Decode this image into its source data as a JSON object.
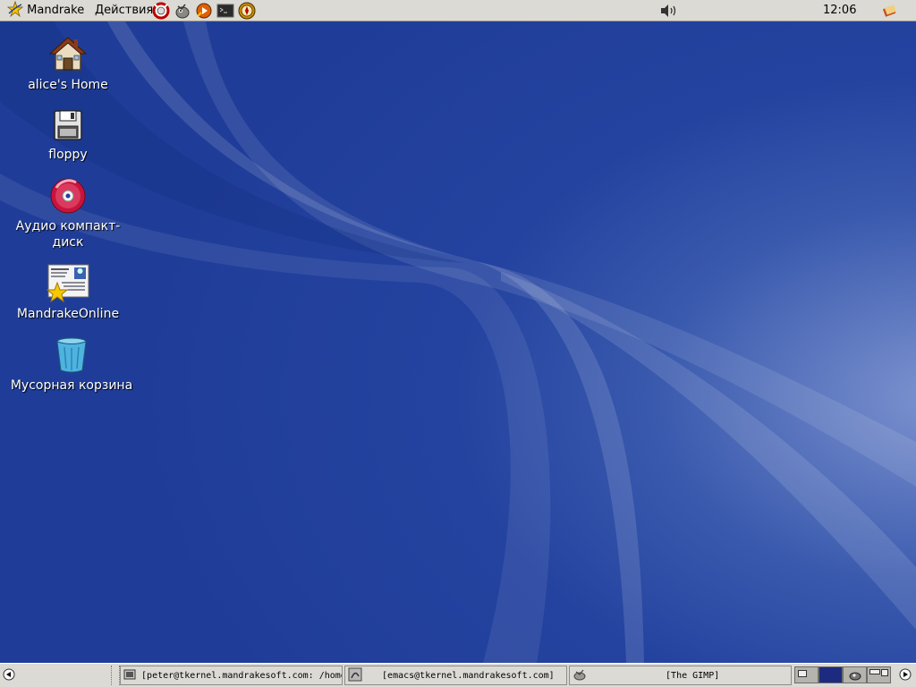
{
  "top_panel": {
    "menu_main": "Mandrake",
    "menu_actions": "Действия",
    "launchers": [
      "lifebuoy-icon",
      "gimp-icon",
      "media-player-icon",
      "terminal-icon",
      "browser-icon"
    ],
    "volume_icon": "speaker-icon",
    "clock": "12:06",
    "notification_icon": "notes-icon"
  },
  "desktop": {
    "icons": [
      {
        "label": "alice's Home",
        "icon": "home-icon"
      },
      {
        "label": "floppy",
        "icon": "floppy-icon"
      },
      {
        "label": "Аудио компакт-диск",
        "icon": "cd-icon"
      },
      {
        "label": "MandrakeOnline",
        "icon": "mandrakeonline-icon"
      },
      {
        "label": "Мусорная корзина",
        "icon": "trash-icon"
      }
    ]
  },
  "taskbar": {
    "tasks": [
      {
        "label": "[peter@tkernel.mandrakesoft.com: /home",
        "icon": "terminal-icon"
      },
      {
        "label": "[emacs@tkernel.mandrakesoft.com]",
        "icon": "emacs-icon"
      },
      {
        "label": "[The GIMP]",
        "icon": "gimp-icon"
      }
    ]
  },
  "colors": {
    "desktop_bg": "#1f3f9a",
    "panel_bg": "#dcdad5",
    "pager_active": "#1c2a80"
  }
}
